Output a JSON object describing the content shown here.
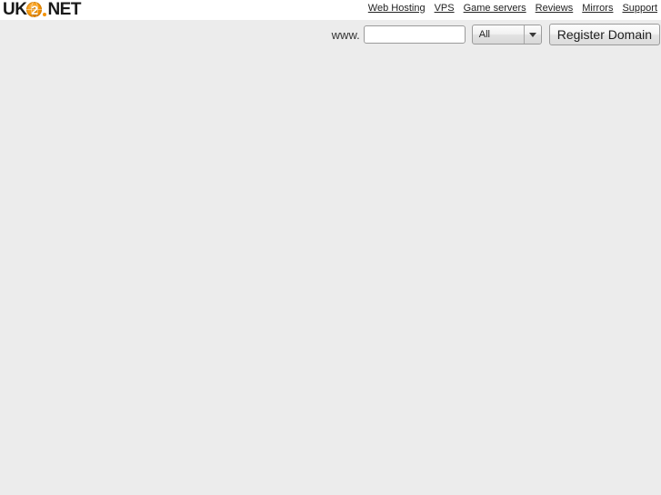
{
  "page": {
    "background_color": "#ececec",
    "header_background_color": "#ffffff"
  },
  "logo": {
    "text_left": "UK",
    "globe_digit": "2",
    "text_right": "NET",
    "accent_color": "#f39200",
    "icon": "globe-icon"
  },
  "topnav": {
    "items": [
      {
        "label": "Web Hosting",
        "name": "nav-link-web-hosting"
      },
      {
        "label": "VPS",
        "name": "nav-link-vps"
      },
      {
        "label": "Game servers",
        "name": "nav-link-game-servers"
      },
      {
        "label": "Reviews",
        "name": "nav-link-reviews"
      },
      {
        "label": "Mirrors",
        "name": "nav-link-mirrors"
      },
      {
        "label": "Support",
        "name": "nav-link-support"
      }
    ]
  },
  "domain_search": {
    "prefix_label": "www.",
    "input_value": "",
    "input_placeholder": "",
    "tld_selected": "All",
    "tld_options": [
      "All"
    ],
    "dropdown_icon": "chevron-down-icon",
    "submit_label": "Register Domain"
  }
}
